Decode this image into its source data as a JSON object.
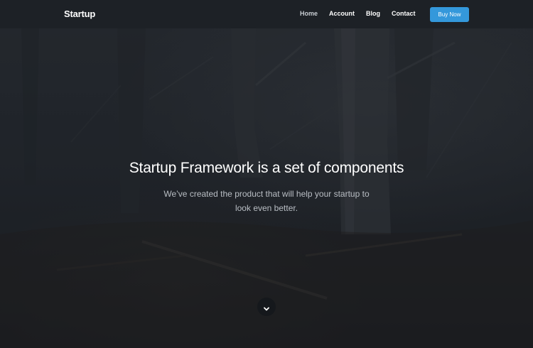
{
  "navbar": {
    "brand": "Startup",
    "links": [
      {
        "label": "Home",
        "active": true
      },
      {
        "label": "Account",
        "active": false
      },
      {
        "label": "Blog",
        "active": false
      },
      {
        "label": "Contact",
        "active": false
      }
    ],
    "cta_label": "Buy Now"
  },
  "hero": {
    "title": "Startup Framework is a set of components",
    "subtitle": "We’ve created the product that will help your startup to look even better.",
    "scroll_icon": "chevron-down-icon"
  },
  "colors": {
    "accent": "#3498db",
    "navbar_bg": "#1d2126",
    "text_primary": "#ffffff",
    "text_muted": "#b9bec4"
  }
}
